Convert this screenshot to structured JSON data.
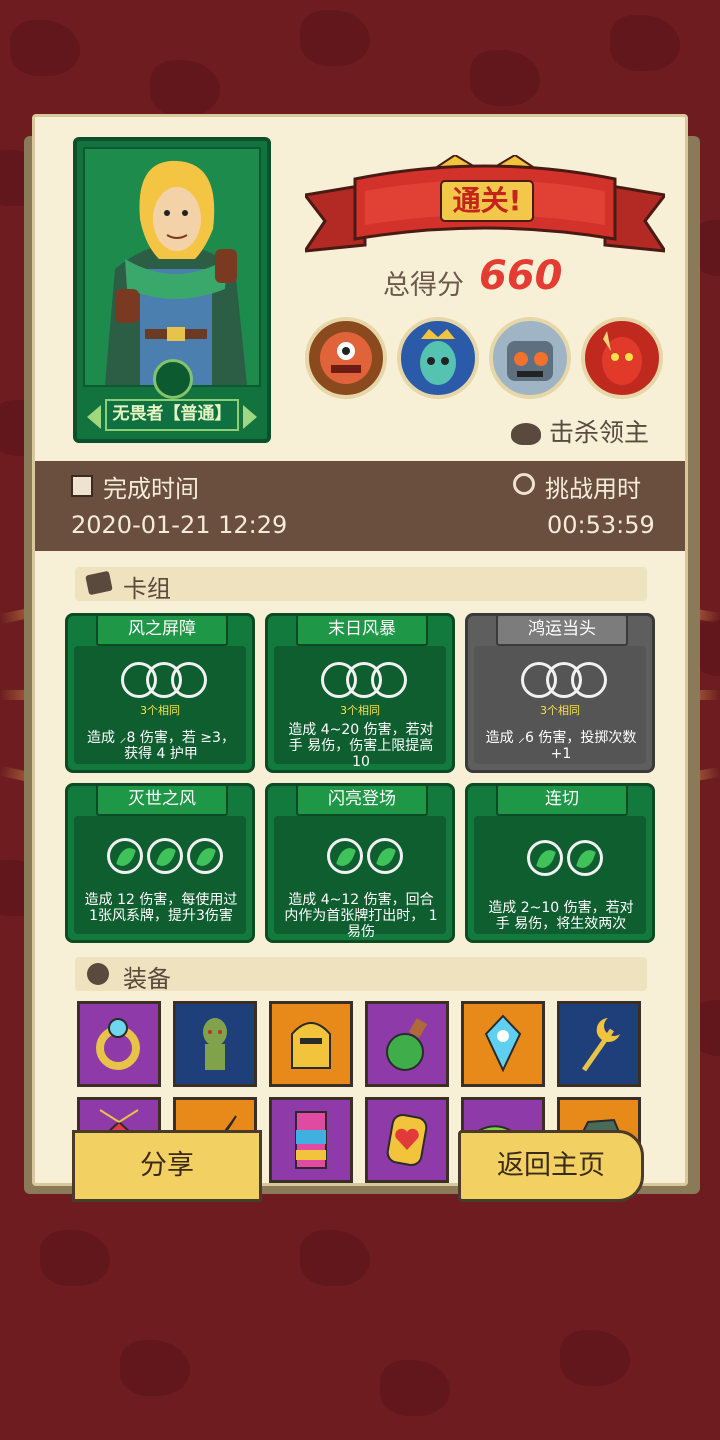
{
  "banner": {
    "title": "通关!"
  },
  "score": {
    "label": "总得分",
    "value": "660"
  },
  "hero": {
    "name": "无畏者【普通】"
  },
  "bosses": {
    "label": "击杀领主"
  },
  "time": {
    "finish_label": "完成时间",
    "finish_value": "2020-01-21 12:29",
    "duration_label": "挑战用时",
    "duration_value": "00:53:59"
  },
  "deck": {
    "title": "卡组",
    "cards": [
      {
        "name": "风之屏障",
        "same": "3个相同",
        "desc": "造成 ⸝8 伤害，若 ≥3，获得 4 护甲"
      },
      {
        "name": "末日风暴",
        "same": "3个相同",
        "desc": "造成 4~20 伤害，若对手 易伤，伤害上限提高10"
      },
      {
        "name": "鸿运当头",
        "same": "3个相同",
        "desc": "造成 ⸝6 伤害，投掷次数+1"
      },
      {
        "name": "灭世之风",
        "desc": "造成 12 伤害，每使用过1张风系牌，提升3伤害"
      },
      {
        "name": "闪亮登场",
        "desc": "造成 4~12 伤害，回合内作为首张牌打出时， 1 易伤"
      },
      {
        "name": "连切",
        "desc": "造成 2~10 伤害，若对手 易伤，将生效两次"
      }
    ]
  },
  "equipment": {
    "title": "装备"
  },
  "buttons": {
    "share": "分享",
    "home": "返回主页"
  },
  "colors": {
    "card_green": "#127a3c",
    "card_gray": "#5e5e5e",
    "score_red": "#e43c32",
    "banner_red": "#d2322a",
    "button_yellow": "#f3d062"
  }
}
